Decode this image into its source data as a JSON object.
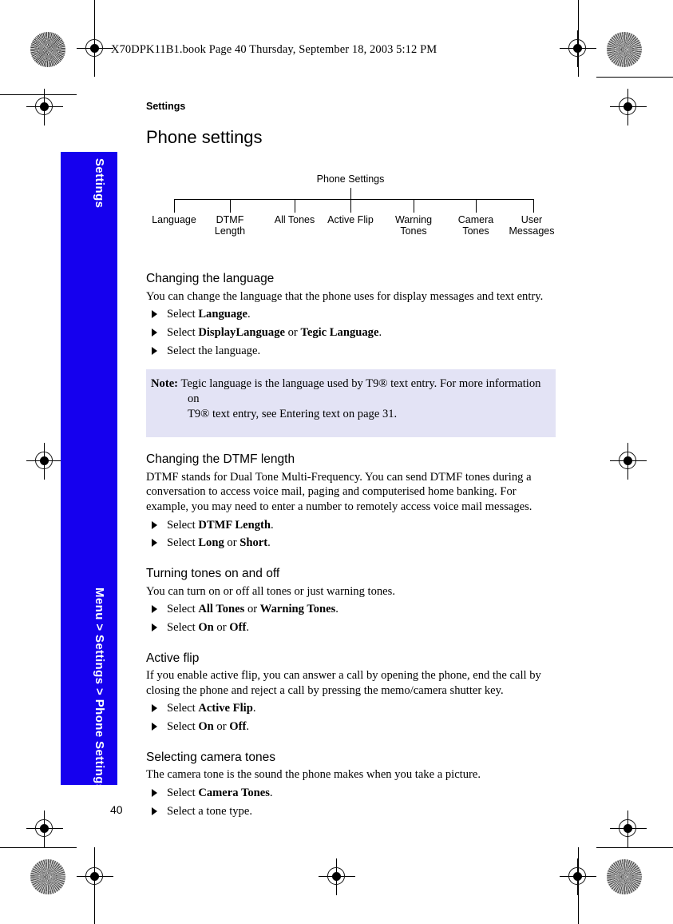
{
  "print_header": {
    "text": "X70DPK11B1.book  Page 40  Thursday, September 18, 2003  5:12 PM"
  },
  "running_head": {
    "text": "Settings"
  },
  "side_tab": {
    "chapter_label": "Settings",
    "breadcrumb_label": "Menu > Settings > Phone Settings",
    "color": "#1500EE",
    "text_color": "#FFFFFF"
  },
  "page_title": "Phone settings",
  "diagram": {
    "root": "Phone Settings",
    "leaves": [
      {
        "label_line1": "Language",
        "label_line2": ""
      },
      {
        "label_line1": "DTMF",
        "label_line2": "Length"
      },
      {
        "label_line1": "All Tones",
        "label_line2": ""
      },
      {
        "label_line1": "Active Flip",
        "label_line2": ""
      },
      {
        "label_line1": "Warning",
        "label_line2": "Tones"
      },
      {
        "label_line1": "Camera",
        "label_line2": "Tones"
      },
      {
        "label_line1": "User",
        "label_line2": "Messages"
      }
    ]
  },
  "sections": [
    {
      "heading": "Changing the language",
      "intro": "You can change the language that the phone uses for display messages and text entry.",
      "steps": [
        {
          "pre": "Select ",
          "bold1": "Language",
          "mid": "",
          "bold2": "",
          "post": "."
        },
        {
          "pre": "Select ",
          "bold1": "DisplayLanguage",
          "mid": " or ",
          "bold2": "Tegic Language",
          "post": "."
        },
        {
          "pre": "Select the language.",
          "bold1": "",
          "mid": "",
          "bold2": "",
          "post": ""
        }
      ]
    },
    {
      "heading": "Changing the DTMF length",
      "intro": "DTMF stands for Dual Tone Multi-Frequency. You can send DTMF tones during a conversation to access voice mail, paging and computerised home banking. For example, you may need to enter a number to remotely access voice mail messages.",
      "steps": [
        {
          "pre": "Select ",
          "bold1": "DTMF Length",
          "mid": "",
          "bold2": "",
          "post": "."
        },
        {
          "pre": "Select ",
          "bold1": "Long",
          "mid": " or ",
          "bold2": "Short",
          "post": "."
        }
      ]
    },
    {
      "heading": "Turning tones on and off",
      "intro": "You can turn on or off all tones or just warning tones.",
      "steps": [
        {
          "pre": "Select ",
          "bold1": "All Tones",
          "mid": " or ",
          "bold2": "Warning Tones",
          "post": "."
        },
        {
          "pre": "Select ",
          "bold1": "On",
          "mid": " or ",
          "bold2": "Off",
          "post": "."
        }
      ]
    },
    {
      "heading": "Active flip",
      "intro": "If you enable active flip, you can answer a call by opening the phone, end the call by closing the phone and reject a call by pressing the memo/camera shutter key.",
      "steps": [
        {
          "pre": "Select ",
          "bold1": "Active Flip",
          "mid": "",
          "bold2": "",
          "post": "."
        },
        {
          "pre": "Select ",
          "bold1": "On",
          "mid": " or ",
          "bold2": "Off",
          "post": "."
        }
      ]
    },
    {
      "heading": "Selecting camera tones",
      "intro": "The camera tone is the sound the phone makes when you take a picture.",
      "steps": [
        {
          "pre": "Select ",
          "bold1": "Camera Tones",
          "mid": "",
          "bold2": "",
          "post": "."
        },
        {
          "pre": "Select a tone type.",
          "bold1": "",
          "mid": "",
          "bold2": "",
          "post": ""
        }
      ]
    }
  ],
  "note": {
    "label": "Note:",
    "line1": "Tegic language is the language used by T9® text entry. For more information on",
    "line2": "T9® text entry, see Entering text on page 31.",
    "background": "#E3E3F5"
  },
  "folio": "40"
}
